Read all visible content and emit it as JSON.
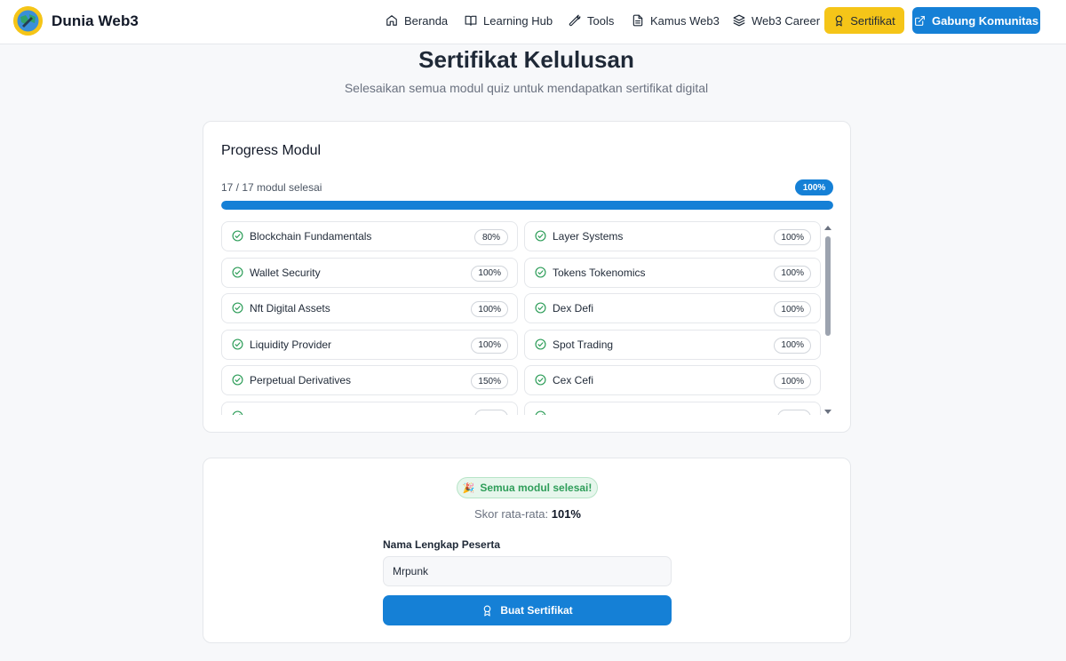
{
  "brand": {
    "name": "Dunia Web3",
    "accent": "#f5c518",
    "primary": "#1580d6"
  },
  "nav": {
    "items": [
      {
        "label": "Beranda",
        "icon": "home-icon"
      },
      {
        "label": "Learning Hub",
        "icon": "book-icon"
      },
      {
        "label": "Tools",
        "icon": "wrench-icon"
      },
      {
        "label": "Kamus Web3",
        "icon": "document-icon"
      },
      {
        "label": "Web3 Career",
        "icon": "layers-icon"
      }
    ],
    "certificate_label": "Sertifikat",
    "join_label": "Gabung Komunitas"
  },
  "header": {
    "title": "Sertifikat Kelulusan",
    "subtitle": "Selesaikan semua modul quiz untuk mendapatkan sertifikat digital"
  },
  "progress": {
    "title": "Progress Modul",
    "count_text": "17 / 17 modul selesai",
    "percent_label": "100%",
    "percent_value": 100,
    "modules": [
      {
        "name": "Blockchain Fundamentals",
        "score": "80%"
      },
      {
        "name": "Layer Systems",
        "score": "100%"
      },
      {
        "name": "Wallet Security",
        "score": "100%"
      },
      {
        "name": "Tokens Tokenomics",
        "score": "100%"
      },
      {
        "name": "Nft Digital Assets",
        "score": "100%"
      },
      {
        "name": "Dex Defi",
        "score": "100%"
      },
      {
        "name": "Liquidity Provider",
        "score": "100%"
      },
      {
        "name": "Spot Trading",
        "score": "100%"
      },
      {
        "name": "Perpetual Derivatives",
        "score": "150%"
      },
      {
        "name": "Cex Cefi",
        "score": "100%"
      },
      {
        "name": "",
        "score": ""
      },
      {
        "name": "",
        "score": ""
      }
    ]
  },
  "certificate": {
    "badge_text": "Semua modul selesai!",
    "avg_label": "Skor rata-rata:",
    "avg_value": "101%",
    "name_label": "Nama Lengkap Peserta",
    "name_value": "Mrpunk",
    "button_label": "Buat Sertifikat"
  }
}
